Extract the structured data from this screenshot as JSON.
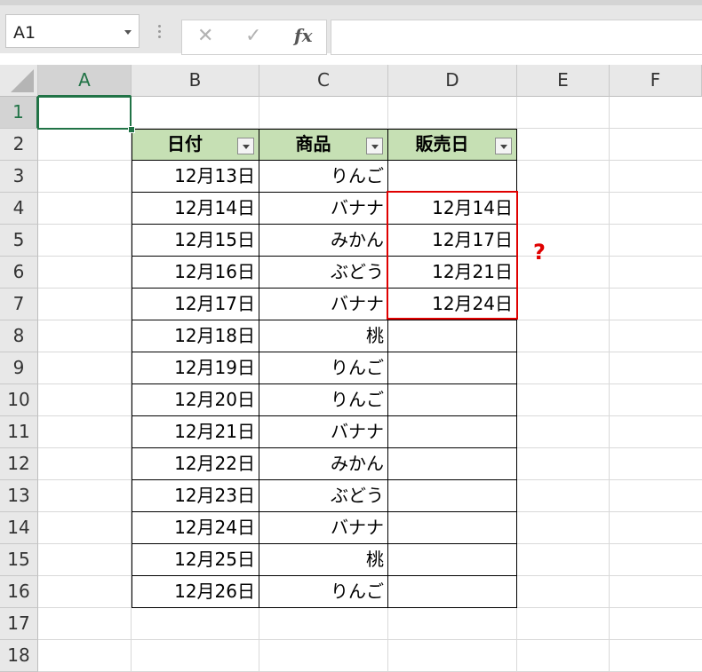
{
  "name_box": {
    "value": "A1"
  },
  "formula_bar": {
    "cancel_glyph": "✕",
    "enter_glyph": "✓",
    "fx_label": "fx",
    "value": ""
  },
  "columns": [
    "A",
    "B",
    "C",
    "D",
    "E",
    "F"
  ],
  "rows": [
    "1",
    "2",
    "3",
    "4",
    "5",
    "6",
    "7",
    "8",
    "9",
    "10",
    "11",
    "12",
    "13",
    "14",
    "15",
    "16",
    "17",
    "18"
  ],
  "table": {
    "headers": [
      "日付",
      "商品",
      "販売日"
    ],
    "dates": [
      "12月13日",
      "12月14日",
      "12月15日",
      "12月16日",
      "12月17日",
      "12月18日",
      "12月19日",
      "12月20日",
      "12月21日",
      "12月22日",
      "12月23日",
      "12月24日",
      "12月25日",
      "12月26日"
    ],
    "products": [
      "りんご",
      "バナナ",
      "みかん",
      "ぶどう",
      "バナナ",
      "桃",
      "りんご",
      "りんご",
      "バナナ",
      "みかん",
      "ぶどう",
      "バナナ",
      "桃",
      "りんご"
    ],
    "sale_dates": [
      "",
      "12月14日",
      "12月17日",
      "12月21日",
      "12月24日",
      "",
      "",
      "",
      "",
      "",
      "",
      "",
      "",
      ""
    ]
  },
  "annotation": {
    "mark": "?"
  },
  "colors": {
    "header_fill": "#c6e0b4",
    "selection": "#217346",
    "highlight": "#e00000"
  }
}
